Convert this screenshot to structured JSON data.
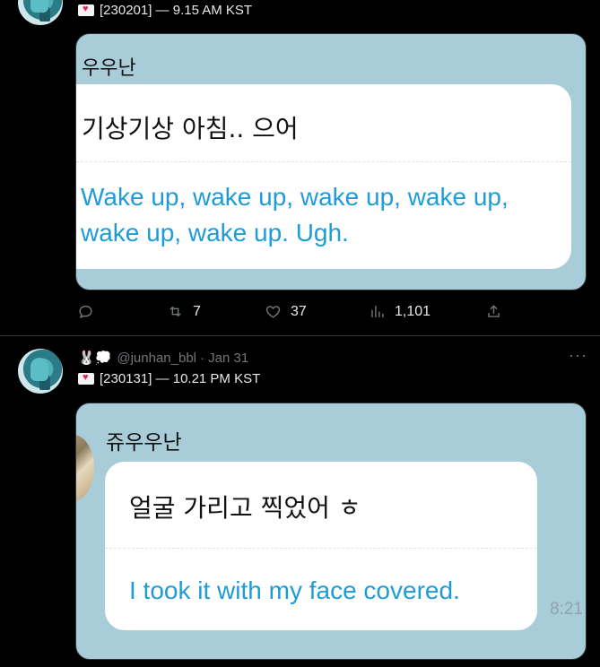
{
  "tweet1": {
    "meta": "[230201] — 9.15 AM KST",
    "sender": "우우난",
    "korean": "기상기상 아침.. 으어",
    "english_line1": "Wake up, wake up, wake up, wake up,",
    "english_line2": "wake up, wake up. Ugh.",
    "retweets": "7",
    "likes": "37",
    "views": "1,101"
  },
  "tweet2": {
    "handle": "@junhan_bbl",
    "date": "· Jan 31",
    "emoji": "🐰💭",
    "meta": "[230131] — 10.21 PM KST",
    "sender": "쥬우우난",
    "korean": "얼굴 가리고 찍었어 ㅎ",
    "english": "I took it with my face covered.",
    "time": "8:21"
  },
  "icons": {
    "reply": "reply-icon",
    "retweet": "retweet-icon",
    "like": "heart-icon",
    "views": "views-icon",
    "share": "share-icon",
    "more": "more-icon",
    "envelope": "envelope-heart-icon"
  },
  "colors": {
    "background": "#000000",
    "media_bg": "#a9ccd9",
    "english_text": "#1e9cd7",
    "muted": "#71767b"
  }
}
